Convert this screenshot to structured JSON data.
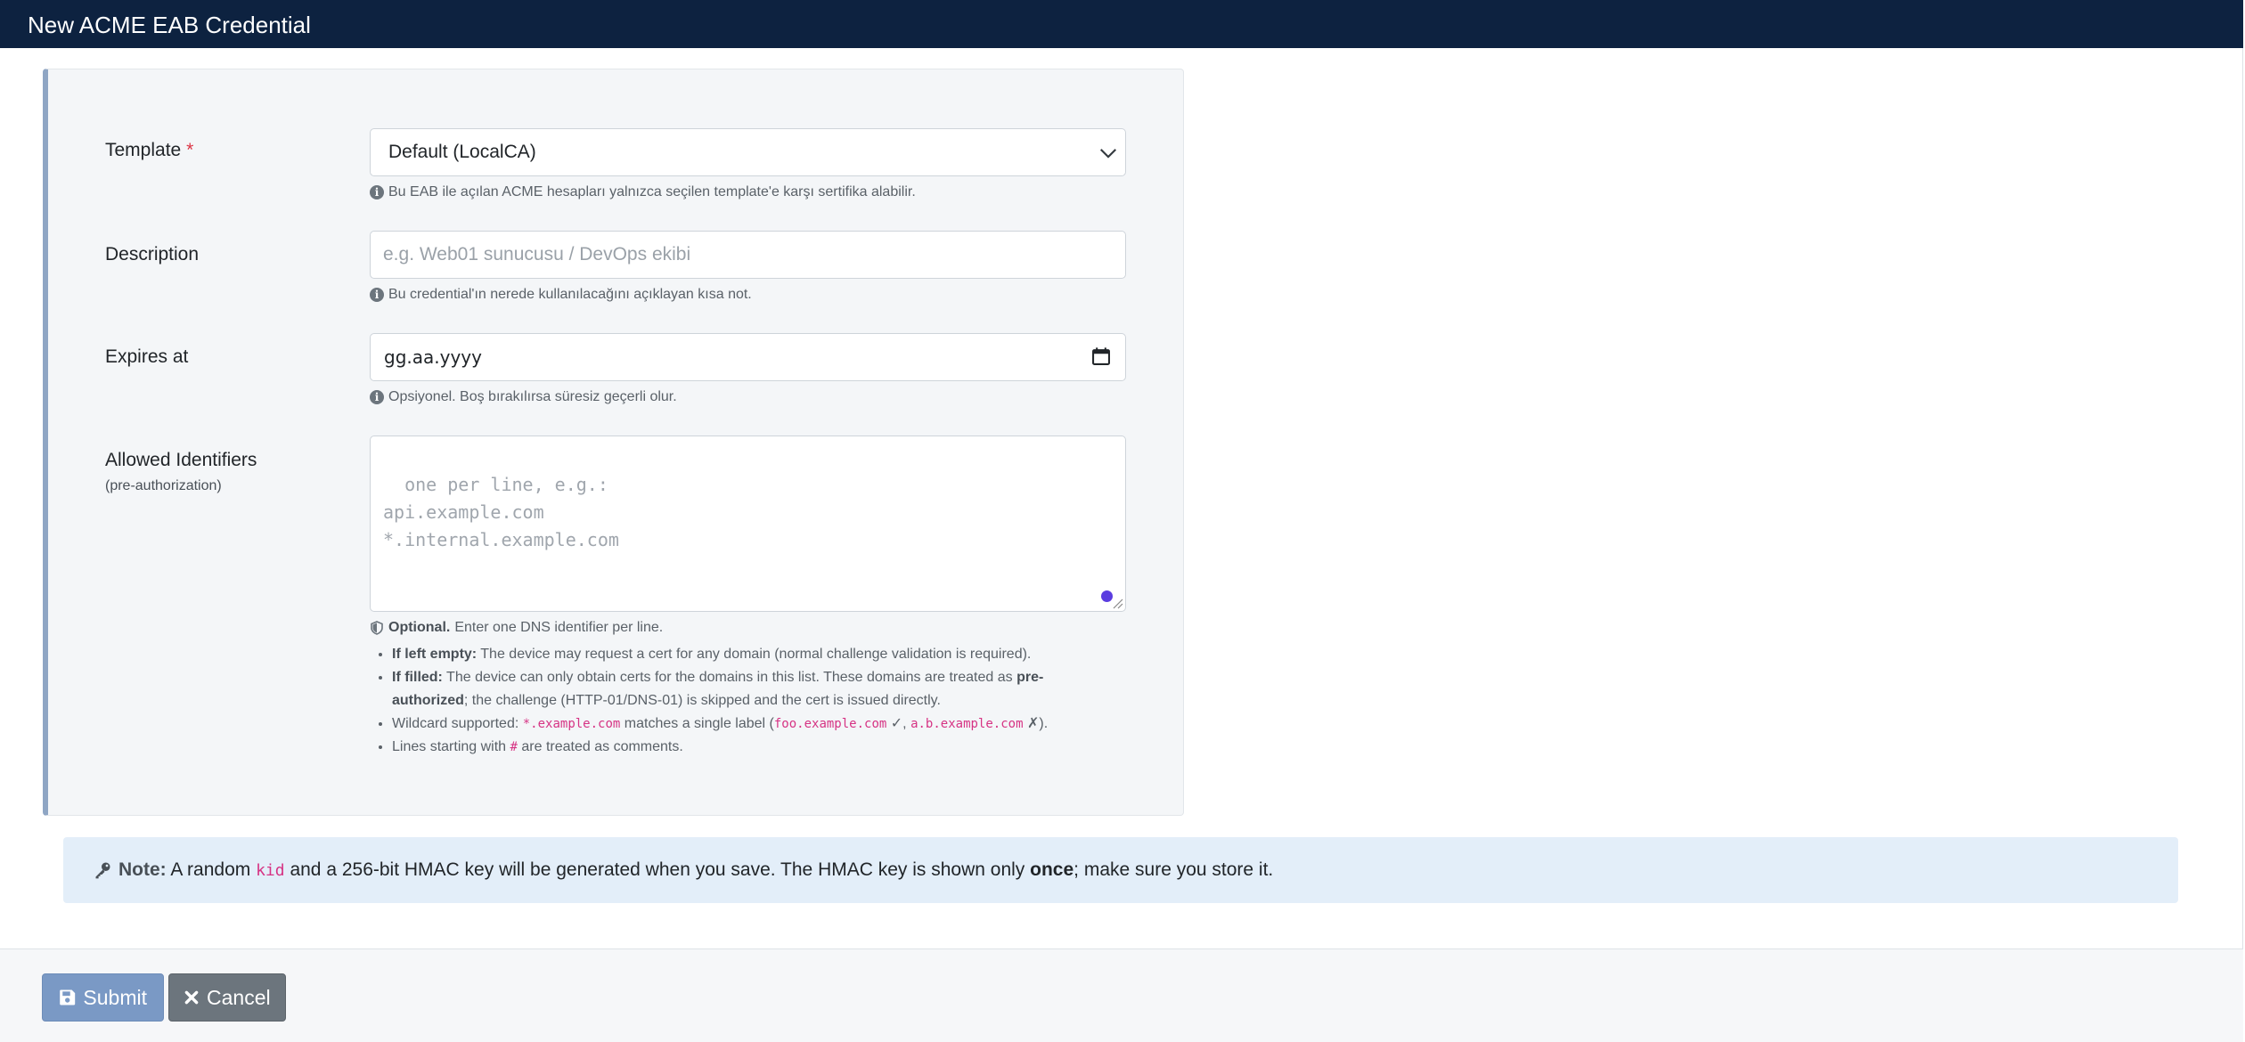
{
  "header": {
    "title": "New ACME EAB Credential"
  },
  "form": {
    "template": {
      "label": "Template",
      "required_mark": "*",
      "value": "Default (LocalCA)",
      "help": "Bu EAB ile açılan ACME hesapları yalnızca seçilen template'e karşı sertifika alabilir."
    },
    "description": {
      "label": "Description",
      "placeholder": "e.g. Web01 sunucusu / DevOps ekibi",
      "help": "Bu credential'ın nerede kullanılacağını açıklayan kısa not."
    },
    "expires": {
      "label": "Expires at",
      "value": "gg.aa.yyyy",
      "help": "Opsiyonel. Boş bırakılırsa süresiz geçerli olur."
    },
    "identifiers": {
      "label": "Allowed Identifiers",
      "sublabel": "(pre-authorization)",
      "placeholder": "one per line, e.g.:\napi.example.com\n*.internal.example.com",
      "help_title": "Optional.",
      "help_text": "Enter one DNS identifier per line.",
      "bullet1_bold": "If left empty:",
      "bullet1_text": "The device may request a cert for any domain (normal challenge validation is required).",
      "bullet2_bold": "If filled:",
      "bullet2_text": "The device can only obtain certs for the domains in this list. These domains are treated as",
      "bullet2_bold2": "pre-authorized",
      "bullet2_text2": "; the challenge (HTTP-01/DNS-01) is skipped and the cert is issued directly.",
      "bullet3_text": "Wildcard supported:",
      "bullet3_code1": "*.example.com",
      "bullet3_text2": "matches a single label (",
      "bullet3_code2": "foo.example.com",
      "bullet3_check": "✓,",
      "bullet3_code3": "a.b.example.com",
      "bullet3_cross": "✗).",
      "bullet4_text": "Lines starting with",
      "bullet4_code": "#",
      "bullet4_text2": "are treated as comments."
    }
  },
  "note": {
    "label": "Note:",
    "text1": "A random",
    "code": "kid",
    "text2": "and a 256-bit HMAC key will be generated when you save. The HMAC key is shown only",
    "bold": "once",
    "text3": "; make sure you store it."
  },
  "footer": {
    "submit_label": "Submit",
    "cancel_label": "Cancel"
  },
  "colors": {
    "header_bg": "#0d2240",
    "submit_bg": "#7a99c5",
    "cancel_bg": "#6c757d",
    "note_bg": "#e3eef9",
    "required": "#dc3545"
  },
  "icons": {
    "info": "info-icon",
    "shield": "shield-icon",
    "key": "key-icon",
    "save": "save-icon",
    "close": "close-icon",
    "calendar": "calendar-icon",
    "chevron": "chevron-down-icon"
  }
}
